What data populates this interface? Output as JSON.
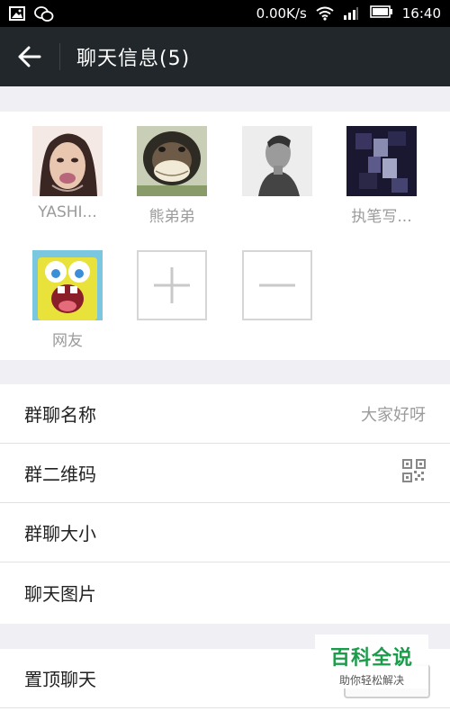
{
  "status_bar": {
    "speed": "0.00K/s",
    "time": "16:40"
  },
  "header": {
    "title": "聊天信息(5)"
  },
  "members": [
    {
      "name": "YASHI..."
    },
    {
      "name": "熊弟弟"
    },
    {
      "name": ""
    },
    {
      "name": "执笔写..."
    },
    {
      "name": "网友"
    }
  ],
  "settings": [
    {
      "label": "群聊名称",
      "value": "大家好呀"
    },
    {
      "label": "群二维码",
      "icon": "qr-code-icon"
    },
    {
      "label": "群聊大小"
    },
    {
      "label": "聊天图片"
    }
  ],
  "settings2": [
    {
      "label": "置顶聊天"
    }
  ],
  "watermark": {
    "main": "百科全说",
    "sub": "助你轻松解决"
  }
}
